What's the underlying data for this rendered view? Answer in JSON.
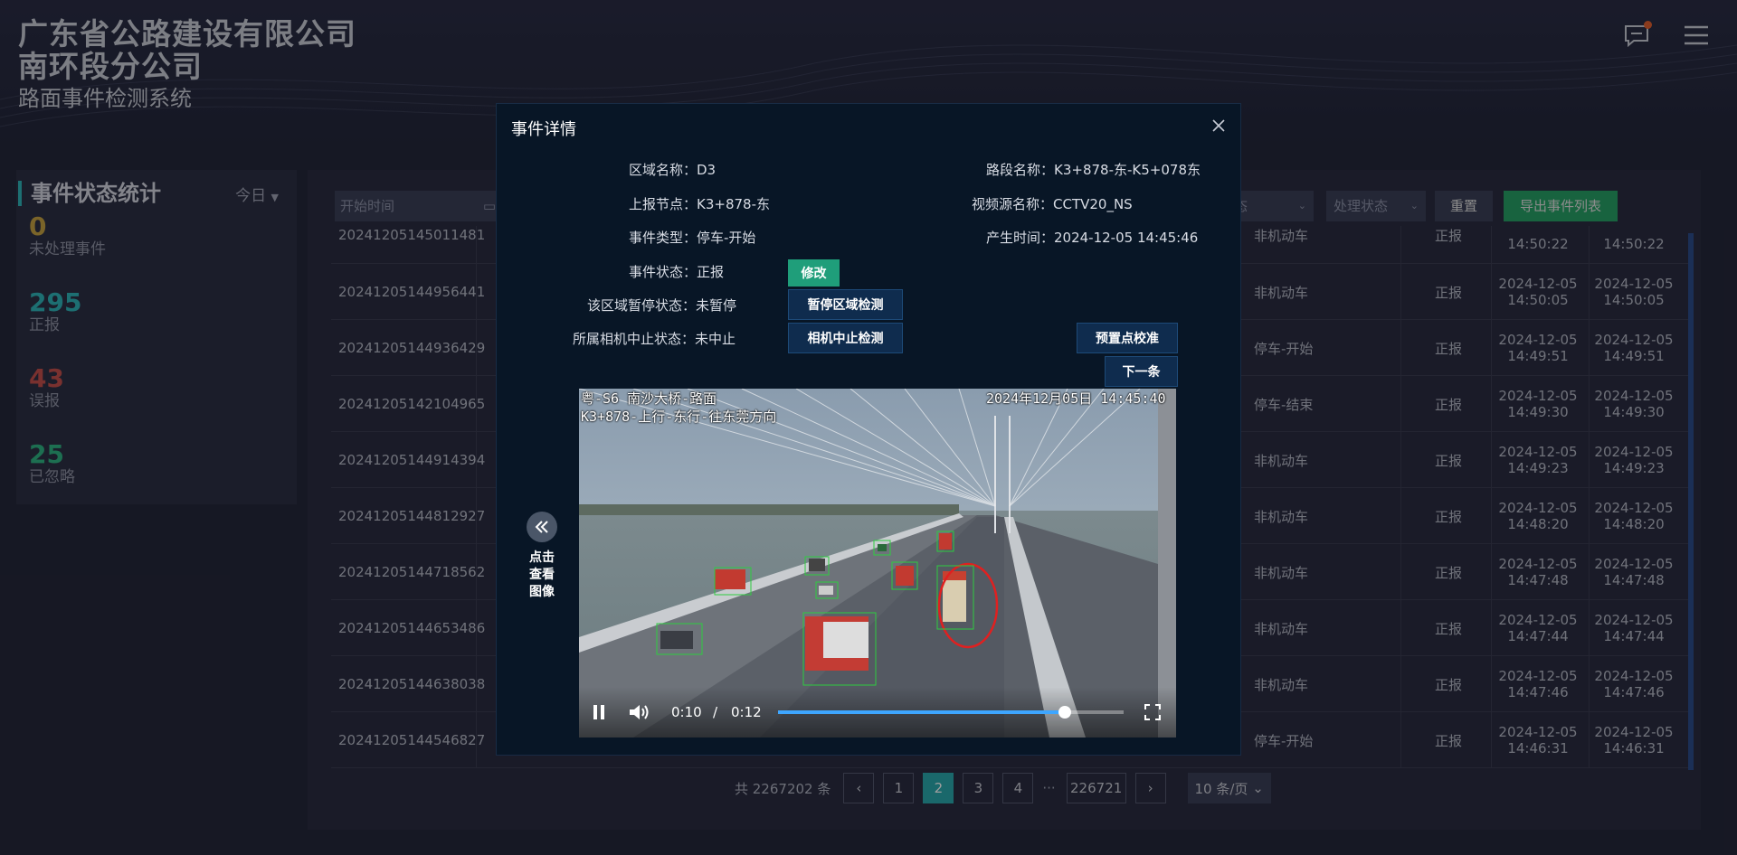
{
  "header": {
    "company_line1": "广东省公路建设有限公司",
    "company_line2": "南环段分公司",
    "system_name": "路面事件检测系统"
  },
  "stats": {
    "title": "事件状态统计",
    "period": "今日",
    "items": [
      {
        "value": "0",
        "label": "未处理事件",
        "color": "#c6a243"
      },
      {
        "value": "295",
        "label": "正报",
        "color": "#2fb3b8"
      },
      {
        "value": "43",
        "label": "误报",
        "color": "#c4504c"
      },
      {
        "value": "25",
        "label": "已忽略",
        "color": "#2fb384"
      }
    ]
  },
  "filters": {
    "start_time": "开始时间",
    "status_partial": "态",
    "process_status": "处理状态",
    "reset": "重置",
    "export": "导出事件列表"
  },
  "table": {
    "rows": [
      {
        "id": "20241205145011481",
        "type": "非机动车",
        "status": "正报",
        "t1d": "",
        "t1t": "14:50:22",
        "t2d": "",
        "t2t": "14:50:22"
      },
      {
        "id": "20241205144956441",
        "type": "非机动车",
        "status": "正报",
        "t1d": "2024-12-05",
        "t1t": "14:50:05",
        "t2d": "2024-12-05",
        "t2t": "14:50:05"
      },
      {
        "id": "20241205144936429",
        "type": "停车-开始",
        "status": "正报",
        "t1d": "2024-12-05",
        "t1t": "14:49:51",
        "t2d": "2024-12-05",
        "t2t": "14:49:51"
      },
      {
        "id": "20241205142104965",
        "type": "停车-结束",
        "status": "正报",
        "t1d": "2024-12-05",
        "t1t": "14:49:30",
        "t2d": "2024-12-05",
        "t2t": "14:49:30"
      },
      {
        "id": "20241205144914394",
        "type": "非机动车",
        "status": "正报",
        "t1d": "2024-12-05",
        "t1t": "14:49:23",
        "t2d": "2024-12-05",
        "t2t": "14:49:23"
      },
      {
        "id": "20241205144812927",
        "type": "非机动车",
        "status": "正报",
        "t1d": "2024-12-05",
        "t1t": "14:48:20",
        "t2d": "2024-12-05",
        "t2t": "14:48:20"
      },
      {
        "id": "20241205144718562",
        "type": "非机动车",
        "status": "正报",
        "t1d": "2024-12-05",
        "t1t": "14:47:48",
        "t2d": "2024-12-05",
        "t2t": "14:47:48"
      },
      {
        "id": "20241205144653486",
        "type": "非机动车",
        "status": "正报",
        "t1d": "2024-12-05",
        "t1t": "14:47:44",
        "t2d": "2024-12-05",
        "t2t": "14:47:44"
      },
      {
        "id": "20241205144638038",
        "type": "非机动车",
        "status": "正报",
        "t1d": "2024-12-05",
        "t1t": "14:47:46",
        "t2d": "2024-12-05",
        "t2t": "14:47:46"
      },
      {
        "id": "20241205144546827",
        "type": "停车-开始",
        "status": "正报",
        "t1d": "2024-12-05",
        "t1t": "14:46:31",
        "t2d": "2024-12-05",
        "t2t": "14:46:31"
      }
    ]
  },
  "pager": {
    "total": "共 2267202 条",
    "prev": "‹",
    "pages": [
      "1",
      "2",
      "3",
      "4"
    ],
    "ellipsis": "···",
    "last": "226721",
    "next": "›",
    "page_size": "10 条/页"
  },
  "modal": {
    "title": "事件详情",
    "area_name": "区域名称：D3",
    "road_name": "路段名称：K3+878-东-K5+078东",
    "report_node": "上报节点：K3+878-东",
    "video_source": "视频源名称：CCTV20_NS",
    "event_type": "事件类型：停车-开始",
    "generated_time": "产生时间：2024-12-05 14:45:46",
    "event_status": "事件状态：正报",
    "pause_status": "该区域暂停状态：未暂停",
    "camera_status": "所属相机中止状态：未中止",
    "btn_modify": "修改",
    "btn_pause": "暂停区域检测",
    "btn_camera": "相机中止检测",
    "btn_preset": "预置点校准",
    "btn_next": "下一条",
    "view_image": "点击查看图像"
  },
  "video": {
    "osd_line1": "粤-S6 南沙大桥-路面",
    "osd_line2": "K3+878-上行-东行-往东莞方向",
    "osd_datetime": "2024年12月05日 14:45:40",
    "current_time": "0:10",
    "separator": "/",
    "duration": "0:12",
    "progress": 0.83
  }
}
